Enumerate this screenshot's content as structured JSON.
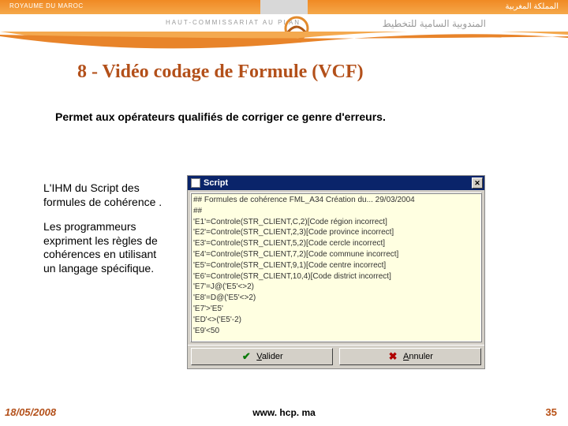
{
  "header": {
    "country_fr": "ROYAUME DU MAROC",
    "country_ar": "المملكة المغربية",
    "org_fr": "HAUT-COMMISSARIAT AU PLAN",
    "org_ar": "المندوبية السامية للتخطيط"
  },
  "title": "8 - Vidéo codage de Formule (VCF)",
  "intro": "Permet aux opérateurs qualifiés de corriger ce genre d'erreurs.",
  "leftcol": {
    "p1": "L'IHM du Script des formules de cohérence .",
    "p2": "Les programmeurs expriment les règles de cohérences en utilisant un langage spécifique."
  },
  "window": {
    "title": "Script",
    "close": "✕",
    "script_lines": [
      "## Formules de cohérence FML_A34 Création du... 29/03/2004",
      "##",
      "'E1'=Controle(STR_CLIENT,C,2)[Code région incorrect]",
      "'E2'=Controle(STR_CLIENT,2,3)[Code province incorrect]",
      "'E3'=Controle(STR_CLIENT,5,2)[Code cercle incorrect]",
      "'E4'=Controle(STR_CLIENT,7,2)[Code commune incorrect]",
      "'E5'=Controle(STR_CLIENT,9,1)[Code centre incorrect]",
      "'E6'=Controle(STR_CLIENT,10,4)[Code district incorrect]",
      "'E7'=J@('E5'<>2)",
      "'E8'=D@('E5'<>2)",
      "'E7'>'E5'",
      "'ED'<>('E5'-2)",
      "'E9'<50"
    ],
    "validate_label": "Valider",
    "cancel_label": "Annuler"
  },
  "footer": {
    "date": "18/05/2008",
    "url": "www. hcp. ma",
    "page": "35"
  }
}
